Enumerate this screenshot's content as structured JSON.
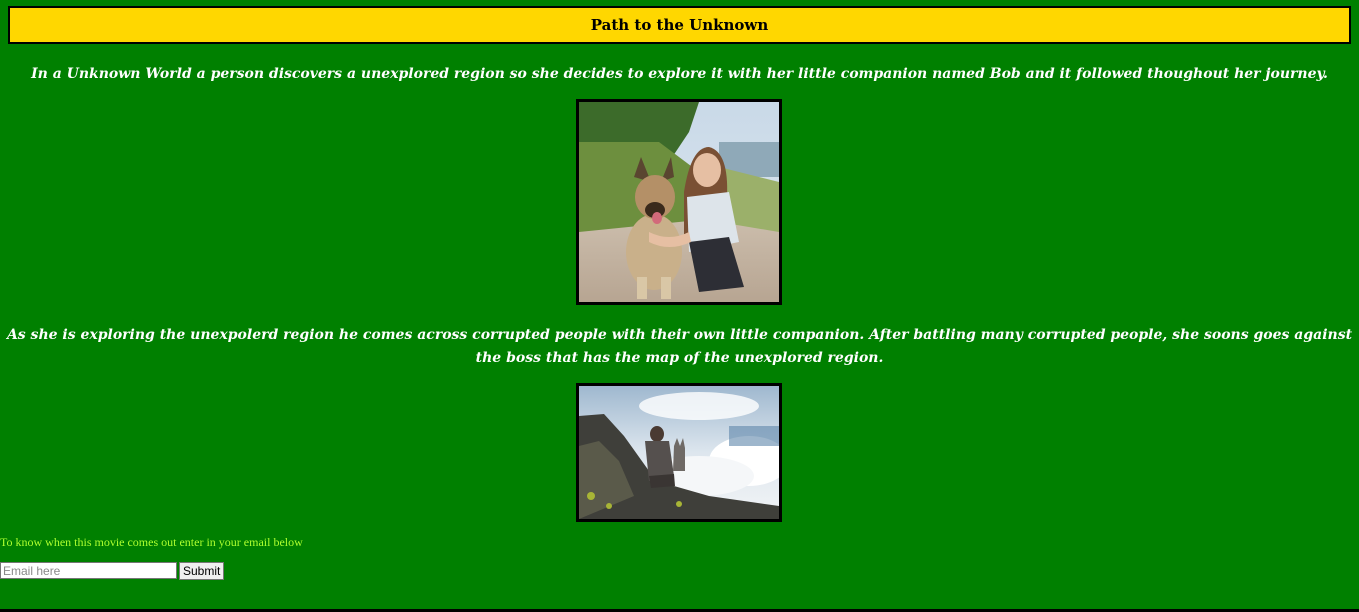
{
  "header": {
    "title": "Path to the Unknown"
  },
  "story": {
    "paragraph_1": "In a Unknown World a person discovers a unexplored region so she decides to explore it with her little companion named Bob and it followed thoughout her journey.",
    "paragraph_2": "As she is exploring the unexpolerd region he comes across corrupted people with their own little companion. After battling many corrupted people, she soons goes against the boss that has the map of the unexplored region."
  },
  "images": {
    "photo_1": "woman-with-dog-on-beach",
    "photo_2": "hiker-with-dog-on-mountain"
  },
  "signup": {
    "prompt": "To know when this movie comes out enter in your email below",
    "email_placeholder": "Email here",
    "email_value": "",
    "submit_label": "Submit"
  },
  "colors": {
    "background": "#008000",
    "title_bar": "#FFD700",
    "prompt_text": "#ADFF2F",
    "story_text": "#FFFFFF"
  }
}
